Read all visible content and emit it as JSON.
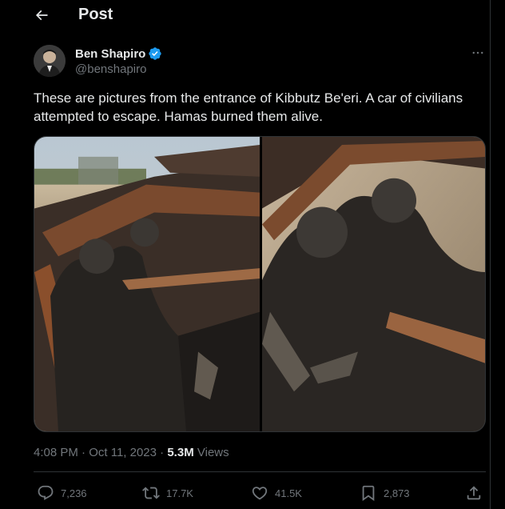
{
  "header": {
    "title": "Post"
  },
  "author": {
    "name": "Ben Shapiro",
    "handle": "@benshapiro",
    "verified": true
  },
  "post": {
    "text": "These are pictures from the entrance of Kibbutz Be'eri. A car of civilians attempted to escape. Hamas burned them alive.",
    "image_count": 2
  },
  "meta": {
    "time": "4:08 PM",
    "separator": "·",
    "date": "Oct 11, 2023",
    "views_count": "5.3M",
    "views_label": "Views"
  },
  "actions": {
    "replies": "7,236",
    "reposts": "17.7K",
    "likes": "41.5K",
    "bookmarks": "2,873"
  },
  "colors": {
    "background": "#000000",
    "text_primary": "#e7e9ea",
    "text_secondary": "#71767b",
    "border": "#2f3336",
    "verified_blue": "#1d9bf0"
  },
  "icons": [
    "back-arrow-icon",
    "verified-badge-icon",
    "more-icon",
    "reply-icon",
    "repost-icon",
    "like-icon",
    "bookmark-icon",
    "share-icon"
  ]
}
